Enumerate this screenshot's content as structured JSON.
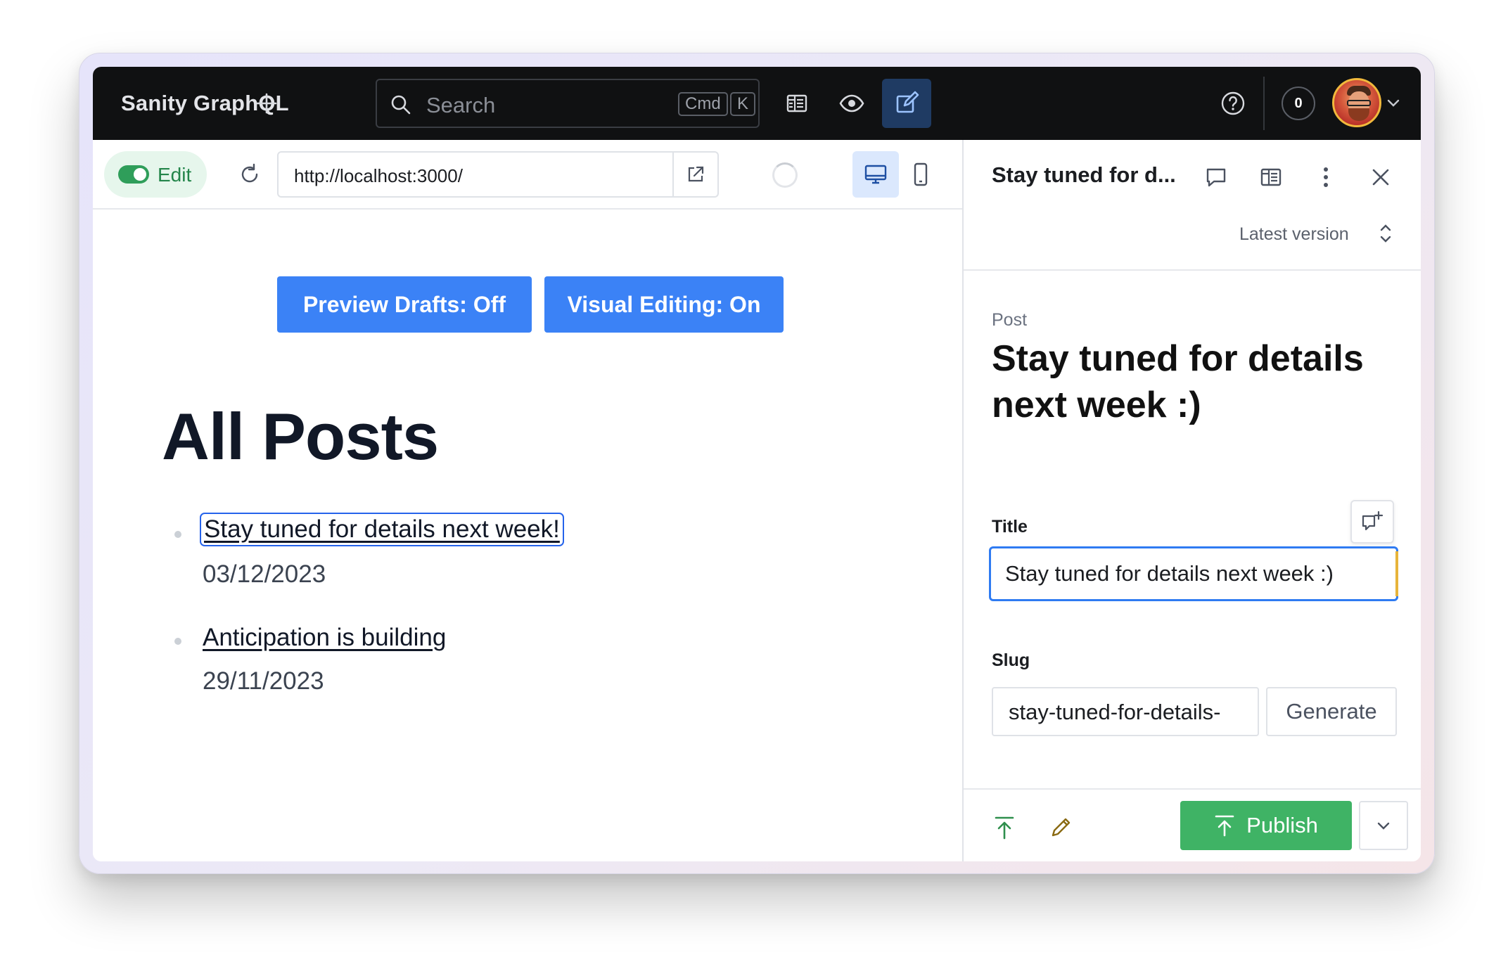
{
  "topbar": {
    "brand": "Sanity GraphQL",
    "search_placeholder": "Search",
    "shortcut_cmd": "Cmd",
    "shortcut_key": "K",
    "notifications_count": "0"
  },
  "preview": {
    "edit_label": "Edit",
    "edit_enabled": true,
    "url": "http://localhost:3000/",
    "buttons": {
      "preview_drafts": "Preview Drafts: Off",
      "visual_editing": "Visual Editing: On"
    },
    "heading": "All Posts",
    "posts": [
      {
        "title": "Stay tuned for details next week!",
        "date": "03/12/2023"
      },
      {
        "title": "Anticipation is building",
        "date": "29/11/2023"
      }
    ]
  },
  "document": {
    "header_title": "Stay tuned for d...",
    "version": "Latest version",
    "type": "Post",
    "title": "Stay tuned for details next week :)",
    "fields": {
      "title_label": "Title",
      "title_value": "Stay tuned for details next week :)",
      "slug_label": "Slug",
      "slug_value": "stay-tuned-for-details-",
      "generate_label": "Generate"
    },
    "publish_label": "Publish"
  },
  "colors": {
    "accent_blue": "#3b82f6",
    "publish_green": "#3fb365",
    "topbar_bg": "#101112"
  }
}
